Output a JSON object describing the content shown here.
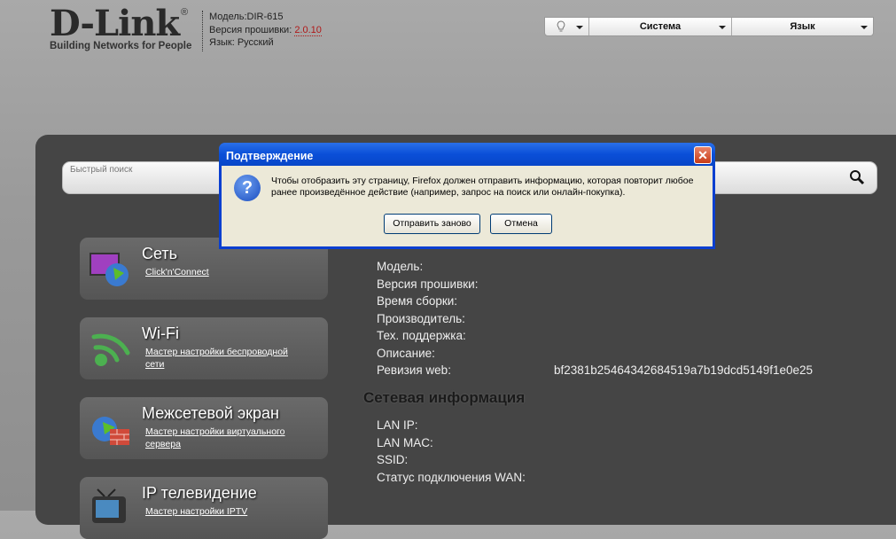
{
  "header": {
    "logo_text": "D-Link",
    "logo_tagline": "Building Networks for People",
    "model": "Модель:DIR-615",
    "firmware_label": "Версия прошивки:",
    "firmware_version": "2.0.10",
    "language": "Язык: Русский"
  },
  "topbar": {
    "system_label": "Система",
    "language_label": "Язык"
  },
  "search": {
    "placeholder": "Быстрый поиск"
  },
  "tiles": [
    {
      "title": "Сеть",
      "link": "Click'n'Connect"
    },
    {
      "title": "Wi-Fi",
      "link": "Мастер настройки беспроводной сети"
    },
    {
      "title": "Межсетевой экран",
      "link": "Мастер настройки виртуального сервера"
    },
    {
      "title": "IP телевидение",
      "link": "Мастер настройки IPTV"
    }
  ],
  "device_info": {
    "rows": [
      {
        "label": "Модель:",
        "value": ""
      },
      {
        "label": "Версия прошивки:",
        "value": ""
      },
      {
        "label": "Время сборки:",
        "value": ""
      },
      {
        "label": "Производитель:",
        "value": ""
      },
      {
        "label": "Тех. поддержка:",
        "value": ""
      },
      {
        "label": "Описание:",
        "value": ""
      },
      {
        "label": "Ревизия web:",
        "value": "bf2381b25464342684519a7b19dcd5149f1e0e25"
      }
    ]
  },
  "network_info": {
    "heading": "Сетевая информация",
    "rows": [
      {
        "label": "LAN IP:"
      },
      {
        "label": "LAN MAC:"
      },
      {
        "label": "SSID:"
      },
      {
        "label": "Статус подключения WAN:"
      }
    ]
  },
  "dialog": {
    "title": "Подтверждение",
    "message": "Чтобы отобразить эту страницу, Firefox должен отправить информацию, которая повторит любое ранее произведённое действие (например, запрос на поиск или онлайн-покупка).",
    "resend_label": "Отправить заново",
    "cancel_label": "Отмена",
    "close_glyph": "✕",
    "icon_glyph": "?"
  }
}
